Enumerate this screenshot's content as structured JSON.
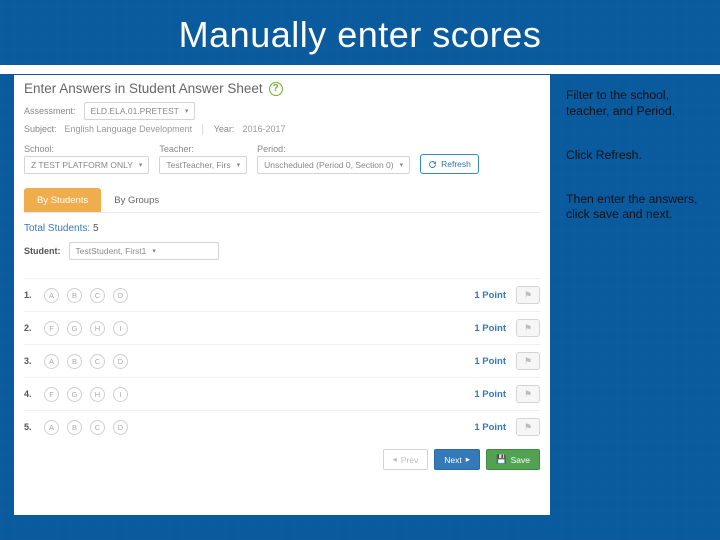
{
  "slide_title": "Manually enter scores",
  "page_header": "Enter Answers in Student Answer Sheet",
  "meta": {
    "assessment_label": "Assessment:",
    "assessment_value": "ELD.ELA.01.PRETEST",
    "subject_label": "Subject:",
    "subject_value": "English Language Development",
    "year_label": "Year:",
    "year_value": "2016-2017"
  },
  "filters": {
    "school": {
      "label": "School:",
      "value": "Z TEST PLATFORM ONLY"
    },
    "teacher": {
      "label": "Teacher:",
      "value": "TestTeacher, Firs"
    },
    "period": {
      "label": "Period:",
      "value": "Unscheduled (Period 0, Section 0)"
    },
    "refresh_label": "Refresh"
  },
  "tabs": {
    "students": "By Students",
    "groups": "By Groups"
  },
  "totals": {
    "label": "Total Students:",
    "count": "5"
  },
  "student": {
    "label": "Student:",
    "value": "TestStudent, First1"
  },
  "questions": [
    {
      "num": "1.",
      "opts": [
        "A",
        "B",
        "C",
        "D"
      ],
      "points": "1 Point"
    },
    {
      "num": "2.",
      "opts": [
        "F",
        "G",
        "H",
        "I"
      ],
      "points": "1 Point"
    },
    {
      "num": "3.",
      "opts": [
        "A",
        "B",
        "C",
        "D"
      ],
      "points": "1 Point"
    },
    {
      "num": "4.",
      "opts": [
        "F",
        "G",
        "H",
        "I"
      ],
      "points": "1 Point"
    },
    {
      "num": "5.",
      "opts": [
        "A",
        "B",
        "C",
        "D"
      ],
      "points": "1 Point"
    }
  ],
  "footer": {
    "prev": "Prev",
    "next": "Next",
    "save": "Save"
  },
  "notes": {
    "n1": "Filter to the school, teacher, and Period.",
    "n2": "Click Refresh.",
    "n3": "Then enter the answers, click save and next."
  }
}
